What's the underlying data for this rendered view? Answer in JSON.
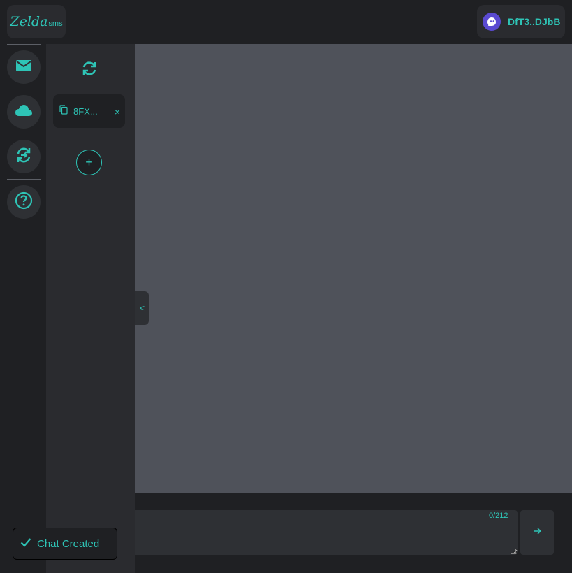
{
  "brand": {
    "name": "Zelda",
    "suffix": "sms"
  },
  "wallet": {
    "address": "DfT3..DJbB",
    "icon": "ghost-icon",
    "avatar_color": "#5a4ad1"
  },
  "rail": {
    "items": [
      {
        "icon": "mail-icon"
      },
      {
        "icon": "cloud-icon"
      },
      {
        "icon": "swap-icon"
      },
      {
        "icon": "help-icon"
      }
    ]
  },
  "chats": {
    "refresh_icon": "refresh-icon",
    "items": [
      {
        "label": "8FX...",
        "copy_icon": "copy-icon",
        "close_label": "×"
      }
    ],
    "add_label": "+"
  },
  "collapse_label": "<",
  "composer": {
    "counter": "0/212",
    "send_icon": "arrow-right-icon"
  },
  "toast": {
    "text": "Chat Created",
    "icon": "check-icon"
  },
  "colors": {
    "accent": "#2ec4b6",
    "panel": "#2a2b2f",
    "background": "#1f2023",
    "message_area": "#4f525a"
  }
}
